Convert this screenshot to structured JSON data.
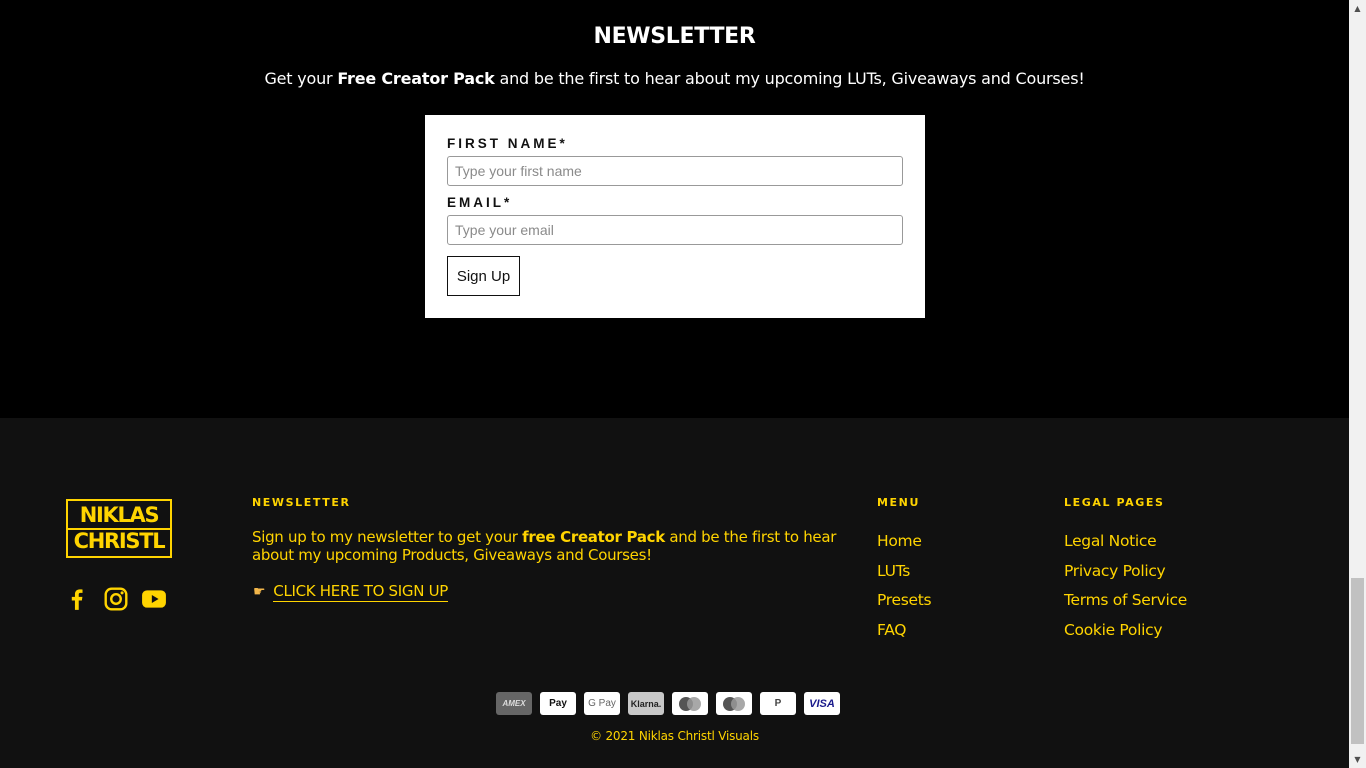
{
  "newsletter": {
    "title": "NEWSLETTER",
    "sub_prefix": "Get your ",
    "sub_bold": "Free Creator Pack",
    "sub_suffix": " and be the first to hear about my upcoming LUTs, Giveaways and Courses!",
    "first_name_label": "FIRST NAME*",
    "first_name_placeholder": "Type your first name",
    "email_label": "EMAIL*",
    "email_placeholder": "Type your email",
    "signup_button": "Sign Up"
  },
  "footer": {
    "logo_line1": "NIKLAS",
    "logo_line2": "CHRISTL",
    "social": [
      {
        "name": "facebook-icon"
      },
      {
        "name": "instagram-icon"
      },
      {
        "name": "youtube-icon"
      }
    ],
    "newsletter_title": "NEWSLETTER",
    "newsletter_text_prefix": "Sign up to my newsletter to get your ",
    "newsletter_text_bold": "free Creator Pack",
    "newsletter_text_suffix": " and be the first to hear about my upcoming Products, Giveaways and Courses!",
    "signup_link": "CLICK HERE TO SIGN UP",
    "menu_title": "MENU",
    "menu_items": [
      "Home",
      "LUTs",
      "Presets",
      "FAQ"
    ],
    "legal_title": "LEGAL PAGES",
    "legal_items": [
      "Legal Notice",
      "Privacy Policy",
      "Terms of Service",
      "Cookie Policy"
    ],
    "payments": [
      "AMEX",
      "Pay",
      "G Pay",
      "Klarna.",
      "",
      "",
      "P",
      "VISA"
    ],
    "copyright": "© 2021 Niklas Christl Visuals"
  },
  "colors": {
    "accent": "#ffd400",
    "footer_bg": "#111111",
    "section_bg": "#000000"
  }
}
